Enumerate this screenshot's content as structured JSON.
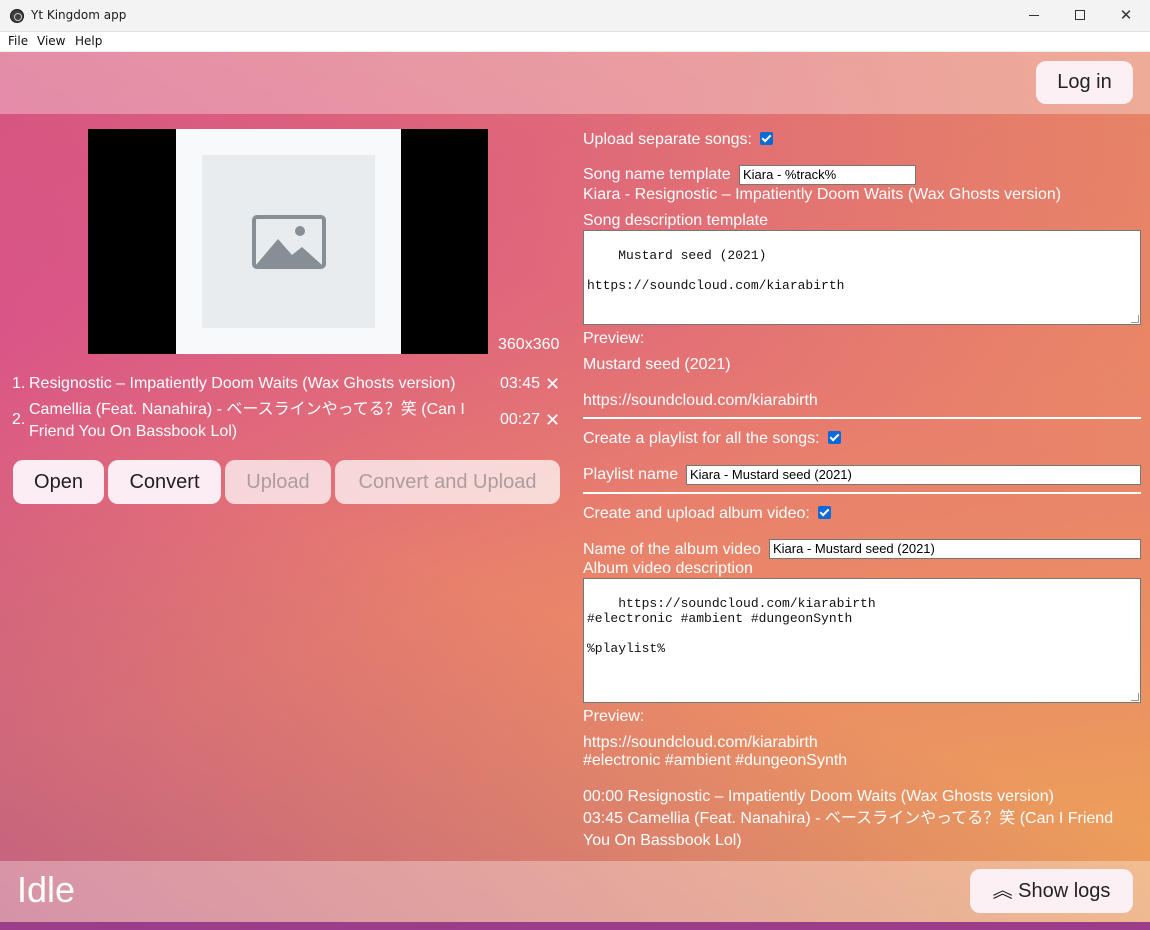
{
  "window": {
    "title": "Yt Kingdom app",
    "minimize": "",
    "maximize": "",
    "close": "✕"
  },
  "menu": [
    "File",
    "View",
    "Help"
  ],
  "header": {
    "login_label": "Log in"
  },
  "thumbnail": {
    "size_label": "360x360"
  },
  "tracks": [
    {
      "num": "1.",
      "name": "Resignostic – Impatiently Doom Waits (Wax Ghosts version)",
      "duration": "03:45",
      "remove": "✕"
    },
    {
      "num": "2.",
      "name": "Camellia (Feat. Nanahira) - ベースラインやってる？笑 (Can I Friend You On Bassbook Lol)",
      "duration": "00:27",
      "remove": "✕"
    }
  ],
  "actions": {
    "open": "Open",
    "convert": "Convert",
    "upload": "Upload",
    "convert_upload": "Convert and Upload"
  },
  "songs": {
    "separate_label": "Upload separate songs:",
    "separate_checked": true,
    "name_template_label": "Song name template",
    "name_template_value": "Kiara - %track%",
    "name_preview": "Kiara - Resignostic – Impatiently Doom Waits (Wax Ghosts version)",
    "desc_template_label": "Song description template",
    "desc_template_value": "Mustard seed (2021)\n\nhttps://soundcloud.com/kiarabirth",
    "preview_label": "Preview:",
    "preview_line1": "Mustard seed (2021)",
    "preview_line2": "https://soundcloud.com/kiarabirth"
  },
  "playlist": {
    "create_label": "Create a playlist for all the songs:",
    "create_checked": true,
    "name_label": "Playlist name",
    "name_value": "Kiara - Mustard seed (2021)"
  },
  "album": {
    "create_label": "Create and upload album video:",
    "create_checked": true,
    "name_label": "Name of the album video",
    "name_value": "Kiara - Mustard seed (2021)",
    "desc_label": "Album video description",
    "desc_value": "https://soundcloud.com/kiarabirth\n#electronic #ambient #dungeonSynth\n\n%playlist%",
    "preview_label": "Preview:",
    "preview_line1": "https://soundcloud.com/kiarabirth",
    "preview_line2": "#electronic #ambient #dungeonSynth",
    "preview_track1": "00:00 Resignostic – Impatiently Doom Waits (Wax Ghosts version)",
    "preview_track2": "03:45 Camellia (Feat. Nanahira) - ベースラインやってる？笑 (Can I Friend You On Bassbook Lol)"
  },
  "status": {
    "text": "Idle",
    "logs_label": "Show logs",
    "logs_icon": "︽"
  },
  "colors": {
    "accent_checkbox": "#0b6ad8",
    "gradient_pink": "#d14a86",
    "gradient_orange": "#eea457"
  }
}
